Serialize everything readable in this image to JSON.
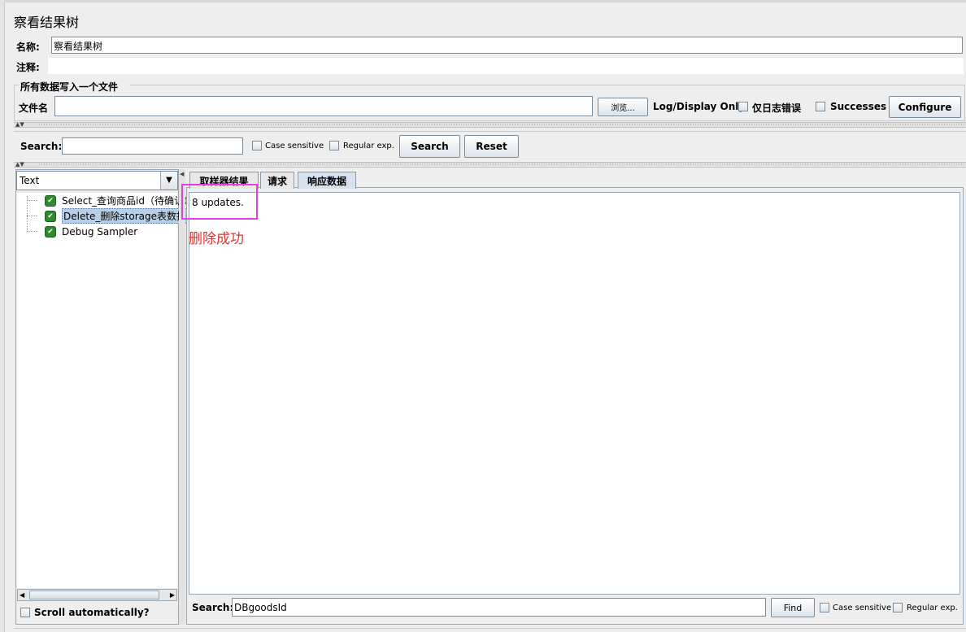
{
  "panel": {
    "title": "察看结果树",
    "name_label": "名称:",
    "name_value": "察看结果树",
    "comment_label": "注释:",
    "comment_value": ""
  },
  "file_group": {
    "legend": "所有数据写入一个文件",
    "filename_label": "文件名",
    "filename_value": "",
    "browse_label": "浏览...",
    "log_display_label": "Log/Display Only:",
    "errors_only_label": "仅日志错误",
    "successes_label": "Successes",
    "configure_label": "Configure"
  },
  "search_bar": {
    "label": "Search:",
    "value": "",
    "case_sensitive_label": "Case sensitive",
    "regex_label": "Regular exp.",
    "search_button": "Search",
    "reset_button": "Reset"
  },
  "renderer": {
    "selected": "Text"
  },
  "tree": {
    "items": [
      {
        "label": "Select_查询商品id（待确认）",
        "status_icon": "success-shield",
        "selected": false
      },
      {
        "label": "Delete_删除storage表数据（",
        "status_icon": "success-shield",
        "selected": true
      },
      {
        "label": "Debug Sampler",
        "status_icon": "success-shield",
        "selected": false
      }
    ],
    "scroll_auto_label": "Scroll automatically?"
  },
  "tabs": [
    {
      "label": "取样器结果",
      "active": false
    },
    {
      "label": "请求",
      "active": false
    },
    {
      "label": "响应数据",
      "active": true
    }
  ],
  "response": {
    "text": "8 updates.",
    "annotation": "删除成功",
    "annotation_color": "#e8322e",
    "highlight_color": "#e040e0"
  },
  "bottom_search": {
    "label": "Search:",
    "value": "DBgoodsId",
    "find_button": "Find",
    "case_sensitive_label": "Case sensitive",
    "regex_label": "Regular exp."
  }
}
